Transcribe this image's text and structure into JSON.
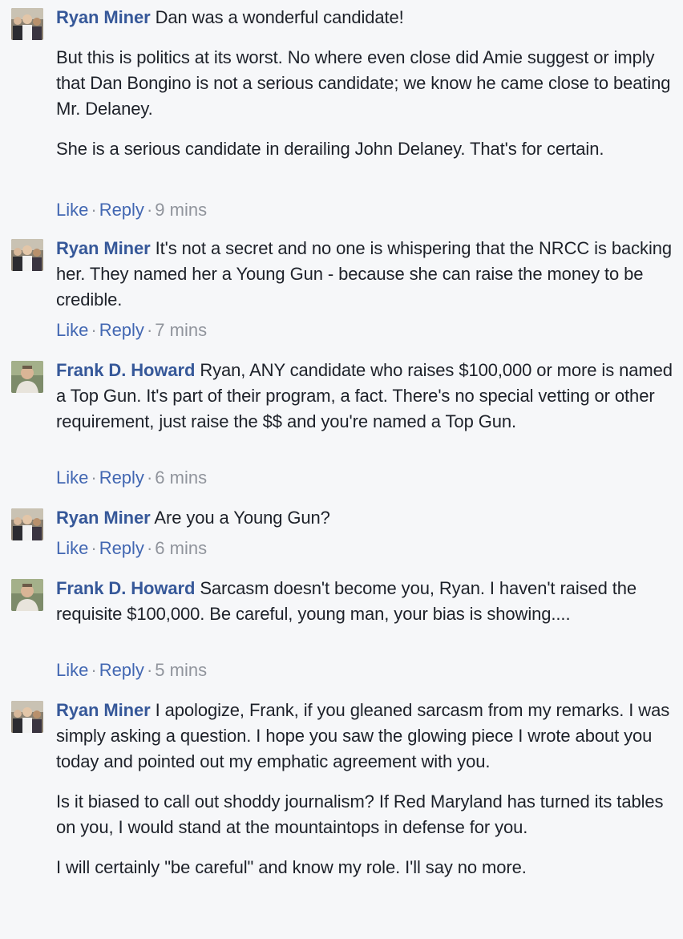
{
  "colors": {
    "background": "#f6f7f9",
    "author": "#365899",
    "action": "#4267b2",
    "timestamp": "#90949c",
    "text": "#1d2129"
  },
  "comments": [
    {
      "author": "Ryan Miner",
      "avatar_icon": "group-photo-avatar",
      "paragraphs": [
        "Dan was a wonderful candidate!",
        "But this is politics at its worst. No where even close did Amie suggest or imply that Dan Bongino is not a serious candidate; we know he came close to beating Mr. Delaney.",
        "She is a serious candidate in derailing John Delaney. That's for certain."
      ],
      "like": "Like",
      "reply": "Reply",
      "separator": "·",
      "time": "9 mins"
    },
    {
      "author": "Ryan Miner",
      "avatar_icon": "group-photo-avatar",
      "paragraphs": [
        "It's not a secret and no one is whispering that the NRCC is backing her. They named her a Young Gun - because she can raise the money to be credible."
      ],
      "like": "Like",
      "reply": "Reply",
      "separator": "·",
      "time": "7 mins"
    },
    {
      "author": "Frank D. Howard",
      "avatar_icon": "portrait-photo-avatar",
      "paragraphs": [
        "Ryan, ANY candidate who raises $100,000 or more is named a Top Gun. It's part of their program, a fact. There's no special vetting or other requirement, just raise the $$ and you're named a Top Gun."
      ],
      "like": "Like",
      "reply": "Reply",
      "separator": "·",
      "time": "6 mins"
    },
    {
      "author": "Ryan Miner",
      "avatar_icon": "group-photo-avatar",
      "paragraphs": [
        "Are you a Young Gun?"
      ],
      "like": "Like",
      "reply": "Reply",
      "separator": "·",
      "time": "6 mins"
    },
    {
      "author": "Frank D. Howard",
      "avatar_icon": "portrait-photo-avatar",
      "paragraphs": [
        "Sarcasm doesn't become you, Ryan. I haven't raised the requisite $100,000. Be careful, young man, your bias is showing...."
      ],
      "like": "Like",
      "reply": "Reply",
      "separator": "·",
      "time": "5 mins"
    },
    {
      "author": "Ryan Miner",
      "avatar_icon": "group-photo-avatar",
      "paragraphs": [
        "I apologize, Frank, if you gleaned sarcasm from my remarks. I was simply asking a question. I hope you saw the glowing piece I wrote about you today and pointed out my emphatic agreement with you.",
        "Is it biased to call out shoddy journalism? If Red Maryland has turned its tables on you, I would stand at the mountaintops in defense for you.",
        "I will certainly \"be careful\" and know my role. I'll say no more."
      ]
    }
  ]
}
